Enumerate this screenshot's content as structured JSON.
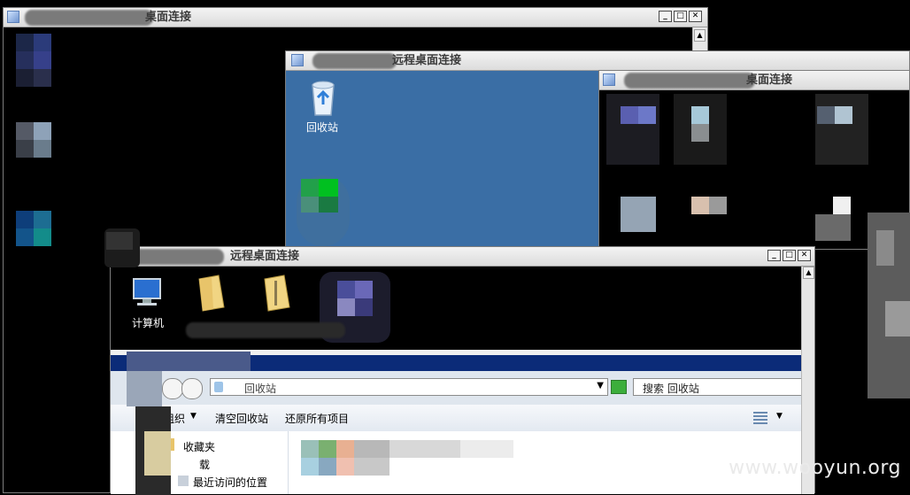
{
  "windows": {
    "back": {
      "title": "桌面连接"
    },
    "middle": {
      "title": "远程桌面连接"
    },
    "right": {
      "title": "桌面连接"
    },
    "front": {
      "title": "远程桌面连接"
    }
  },
  "desktop_icons": {
    "recycle_bin": "回收站",
    "computer": "计算机"
  },
  "explorer": {
    "address_text": "回收站",
    "search_placeholder": "搜索 回收站",
    "toolbar": {
      "organize": "组织",
      "empty_recycle_bin": "清空回收站",
      "restore_all": "还原所有项目"
    },
    "nav": {
      "favorites": "收藏夹",
      "downloads": "载",
      "recent_places": "最近访问的位置"
    }
  },
  "watermark": "www.wooyun.org",
  "colors": {
    "desktop_blue": "#3a6ea5",
    "titlebar": "#e6e6e6",
    "explorer_dark_bar": "#0b2b78"
  }
}
